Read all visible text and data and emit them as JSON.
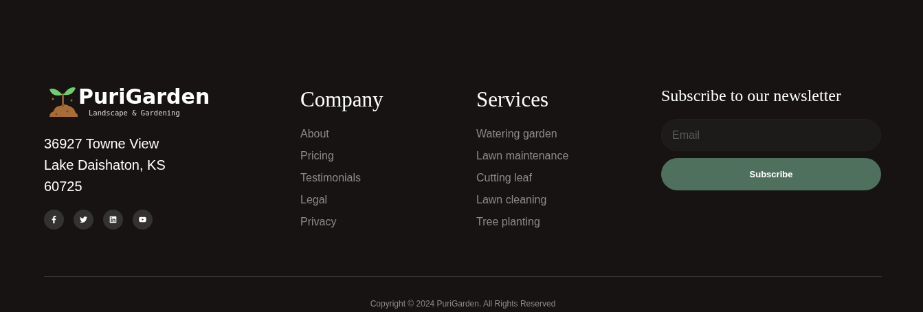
{
  "brand": {
    "name": "PuriGarden",
    "tagline": "Landscape & Gardening",
    "address": [
      "36927 Towne View",
      "Lake Daishaton, KS",
      "60725"
    ],
    "social": [
      {
        "kind": "facebook"
      },
      {
        "kind": "twitter"
      },
      {
        "kind": "linkedin"
      },
      {
        "kind": "youtube"
      }
    ]
  },
  "columns": [
    {
      "title": "Company",
      "links": [
        "About",
        "Pricing",
        "Testimonials",
        "Legal",
        "Privacy"
      ]
    },
    {
      "title": "Services",
      "links": [
        "Watering garden",
        "Lawn maintenance",
        "Cutting leaf",
        "Lawn cleaning",
        "Tree planting"
      ]
    }
  ],
  "newsletter": {
    "title": "Subscribe to our newsletter",
    "placeholder": "Email",
    "button": "Subscribe"
  },
  "copyright": "Copyright © 2024 PuriGarden. All Rights Reserved"
}
